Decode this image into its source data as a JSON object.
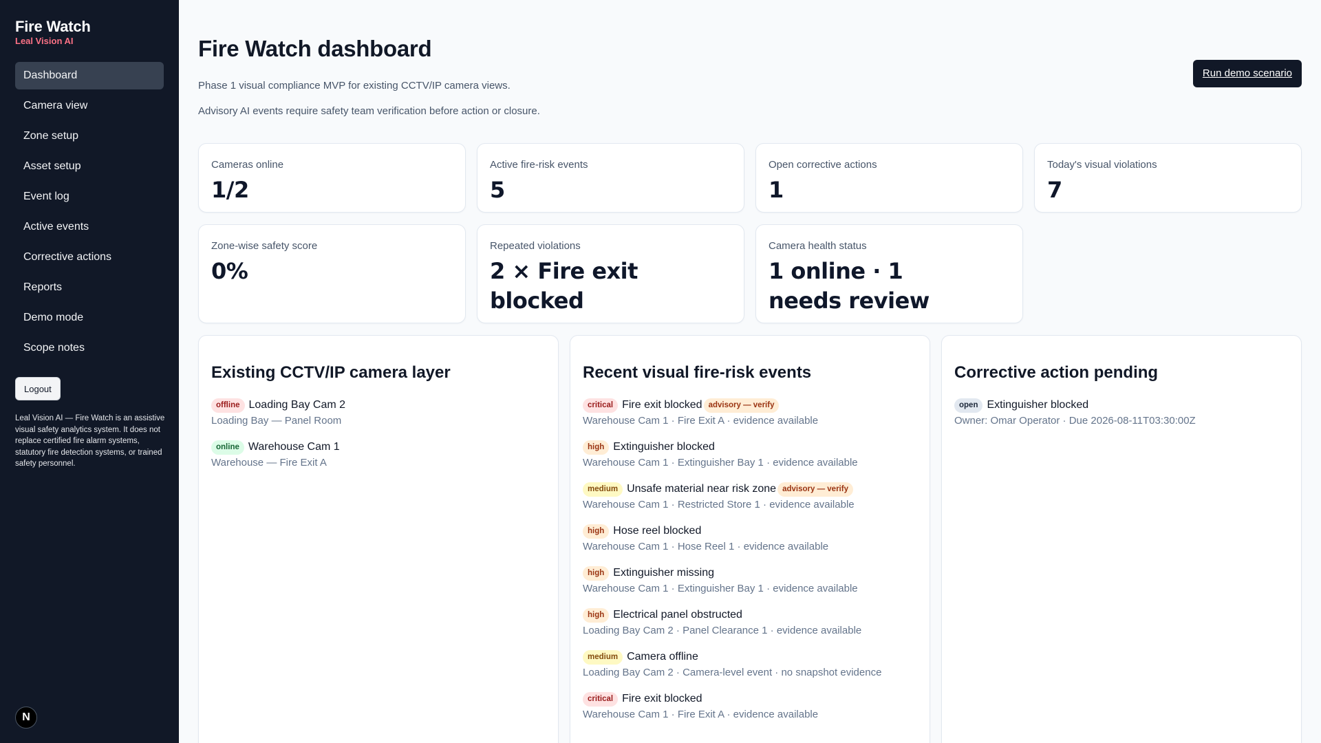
{
  "sidebar": {
    "brand_title": "Fire Watch",
    "brand_subtitle": "Leal Vision AI",
    "nav": [
      {
        "label": "Dashboard",
        "active": true
      },
      {
        "label": "Camera view"
      },
      {
        "label": "Zone setup"
      },
      {
        "label": "Asset setup"
      },
      {
        "label": "Event log"
      },
      {
        "label": "Active events"
      },
      {
        "label": "Corrective actions"
      },
      {
        "label": "Reports"
      },
      {
        "label": "Demo mode"
      },
      {
        "label": "Scope notes"
      }
    ],
    "logout_label": "Logout",
    "disclaimer": "Leal Vision AI — Fire Watch is an assistive visual safety analytics system. It does not replace certified fire alarm systems, statutory fire detection systems, or trained safety personnel.",
    "badge_letter": "N"
  },
  "header": {
    "title": "Fire Watch dashboard",
    "subtitle_1": "Phase 1 visual compliance MVP for existing CCTV/IP camera views.",
    "subtitle_2": "Advisory AI events require safety team verification before action or closure.",
    "run_button": "Run demo scenario"
  },
  "stats": [
    {
      "label": "Cameras online",
      "value": "1/2"
    },
    {
      "label": "Active fire-risk events",
      "value": "5"
    },
    {
      "label": "Open corrective actions",
      "value": "1"
    },
    {
      "label": "Today's visual violations",
      "value": "7"
    },
    {
      "label": "Zone-wise safety score",
      "value": "0%"
    },
    {
      "label": "Repeated violations",
      "value": "2 × Fire exit blocked"
    },
    {
      "label": "Camera health status",
      "value": "1 online · 1 needs review"
    }
  ],
  "cameras_panel": {
    "title": "Existing CCTV/IP camera layer",
    "items": [
      {
        "status": "offline",
        "name": "Loading Bay Cam 2",
        "location": "Loading Bay — Panel Room"
      },
      {
        "status": "online",
        "name": "Warehouse Cam 1",
        "location": "Warehouse — Fire Exit A"
      }
    ]
  },
  "events_panel": {
    "title": "Recent visual fire-risk events",
    "items": [
      {
        "severity": "critical",
        "name": "Fire exit blocked",
        "advisory": "advisory — verify",
        "detail": "Warehouse Cam 1 · Fire Exit A · evidence available"
      },
      {
        "severity": "high",
        "name": "Extinguisher blocked",
        "advisory": "",
        "detail": "Warehouse Cam 1 · Extinguisher Bay 1 · evidence available"
      },
      {
        "severity": "medium",
        "name": "Unsafe material near risk zone",
        "advisory": "advisory — verify",
        "detail": "Warehouse Cam 1 · Restricted Store 1 · evidence available"
      },
      {
        "severity": "high",
        "name": "Hose reel blocked",
        "advisory": "",
        "detail": "Warehouse Cam 1 · Hose Reel 1 · evidence available"
      },
      {
        "severity": "high",
        "name": "Extinguisher missing",
        "advisory": "",
        "detail": "Warehouse Cam 1 · Extinguisher Bay 1 · evidence available"
      },
      {
        "severity": "high",
        "name": "Electrical panel obstructed",
        "advisory": "",
        "detail": "Loading Bay Cam 2 · Panel Clearance 1 · evidence available"
      },
      {
        "severity": "medium",
        "name": "Camera offline",
        "advisory": "",
        "detail": "Loading Bay Cam 2 · Camera-level event · no snapshot evidence"
      },
      {
        "severity": "critical",
        "name": "Fire exit blocked",
        "advisory": "",
        "detail": "Warehouse Cam 1 · Fire Exit A · evidence available"
      }
    ]
  },
  "actions_panel": {
    "title": "Corrective action pending",
    "items": [
      {
        "status": "open",
        "name": "Extinguisher blocked",
        "detail": "Owner: Omar Operator · Due 2026-08-11T03:30:00Z"
      }
    ]
  },
  "colors": {
    "sidebar_bg": "#111827",
    "brand_accent": "#fb7185",
    "critical": "#991b1b",
    "high": "#9a3412",
    "medium": "#854d0e",
    "online": "#166534"
  }
}
